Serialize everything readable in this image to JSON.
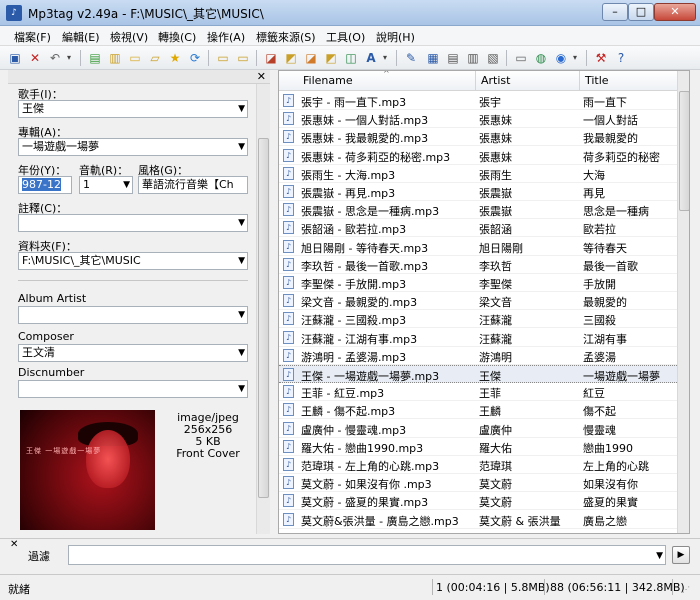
{
  "window": {
    "title": "Mp3tag v2.49a  -  F:\\MUSIC\\_其它\\MUSIC\\",
    "app_icon": "mp3tag-icon"
  },
  "menu": [
    "檔案(F)",
    "編輯(E)",
    "檢視(V)",
    "轉換(C)",
    "操作(A)",
    "標籤來源(S)",
    "工具(O)",
    "說明(H)"
  ],
  "tag_panel": {
    "artist_label": "歌手(I)：",
    "artist_value": "王傑",
    "album_label": "專輯(A)：",
    "album_value": "一場遊戲一場夢",
    "year_label": "年份(Y)：",
    "year_value": "987-12",
    "track_label": "音軌(R)：",
    "track_value": "1",
    "genre_label": "風格(G)：",
    "genre_value": "華語流行音樂【Ch",
    "comment_label": "註釋(C)：",
    "comment_value": "",
    "folder_label": "資料夾(F)：",
    "folder_value": "F:\\MUSIC\\_其它\\MUSIC",
    "album_artist_label": "Album Artist",
    "album_artist_value": "",
    "composer_label": "Composer",
    "composer_value": "王文清",
    "discnumber_label": "Discnumber",
    "discnumber_value": "",
    "cover_text": "王傑 一場遊戲一場夢",
    "cover_info": {
      "type": "image/jpeg",
      "size": "256x256",
      "bytes": "5 KB",
      "kind": "Front Cover"
    }
  },
  "columns": {
    "filename": "Filename",
    "artist": "Artist",
    "title": "Title"
  },
  "files": [
    {
      "filename": "張宇 - 雨一直下.mp3",
      "artist": "張宇",
      "title": "雨一直下"
    },
    {
      "filename": "張惠妹 - 一個人對話.mp3",
      "artist": "張惠妹",
      "title": "一個人對話"
    },
    {
      "filename": "張惠妹 - 我最親愛的.mp3",
      "artist": "張惠妹",
      "title": "我最親愛的"
    },
    {
      "filename": "張惠妹 - 荷多莉亞的秘密.mp3",
      "artist": "張惠妹",
      "title": "荷多莉亞的秘密"
    },
    {
      "filename": "張雨生 - 大海.mp3",
      "artist": "張雨生",
      "title": "大海"
    },
    {
      "filename": "張震嶽 - 再見.mp3",
      "artist": "張震嶽",
      "title": "再見"
    },
    {
      "filename": "張震嶽 - 思念是一種病.mp3",
      "artist": "張震嶽",
      "title": "思念是一種病"
    },
    {
      "filename": "張韶涵 - 歐若拉.mp3",
      "artist": "張韶涵",
      "title": "歐若拉"
    },
    {
      "filename": "旭日陽剛 - 等待春天.mp3",
      "artist": "旭日陽剛",
      "title": "等待春天"
    },
    {
      "filename": "李玖哲 - 最後一首歌.mp3",
      "artist": "李玖哲",
      "title": "最後一首歌"
    },
    {
      "filename": "李聖傑 - 手放開.mp3",
      "artist": "李聖傑",
      "title": "手放開"
    },
    {
      "filename": "梁文音 - 最親愛的.mp3",
      "artist": "梁文音",
      "title": "最親愛的"
    },
    {
      "filename": "汪蘇瀧 - 三國殺.mp3",
      "artist": "汪蘇瀧",
      "title": "三國殺"
    },
    {
      "filename": "汪蘇瀧 - 江湖有事.mp3",
      "artist": "汪蘇瀧",
      "title": "江湖有事"
    },
    {
      "filename": "游鴻明 - 孟婆湯.mp3",
      "artist": "游鴻明",
      "title": "孟婆湯"
    },
    {
      "filename": "王傑 - 一場遊戲一場夢.mp3",
      "artist": "王傑",
      "title": "一場遊戲一場夢"
    },
    {
      "filename": "王菲 - 紅豆.mp3",
      "artist": "王菲",
      "title": "紅豆"
    },
    {
      "filename": "王麟 - 傷不起.mp3",
      "artist": "王麟",
      "title": "傷不起"
    },
    {
      "filename": "盧廣仲 - 慢靈魂.mp3",
      "artist": "盧廣仲",
      "title": "慢靈魂"
    },
    {
      "filename": "羅大佑 - 戀曲1990.mp3",
      "artist": "羅大佑",
      "title": "戀曲1990"
    },
    {
      "filename": "范瑋琪 - 左上角的心跳.mp3",
      "artist": "范瑋琪",
      "title": "左上角的心跳"
    },
    {
      "filename": "莫文蔚 - 如果沒有你 .mp3",
      "artist": "莫文蔚",
      "title": "如果沒有你"
    },
    {
      "filename": "莫文蔚 - 盛夏的果實.mp3",
      "artist": "莫文蔚",
      "title": "盛夏的果實"
    },
    {
      "filename": "莫文蔚&張洪量 - 廣島之戀.mp3",
      "artist": "莫文蔚 & 張洪量",
      "title": "廣島之戀"
    }
  ],
  "selected_index": 15,
  "filter": {
    "label": "過濾",
    "value": ""
  },
  "status": {
    "left": "就緒",
    "selection": "1 (00:04:16 | 5.8MB)",
    "total": "88 (06:56:11 | 342.8MB)"
  },
  "colors": {
    "selection": "#e8edf5",
    "titlebar": "#bcd3ef"
  }
}
